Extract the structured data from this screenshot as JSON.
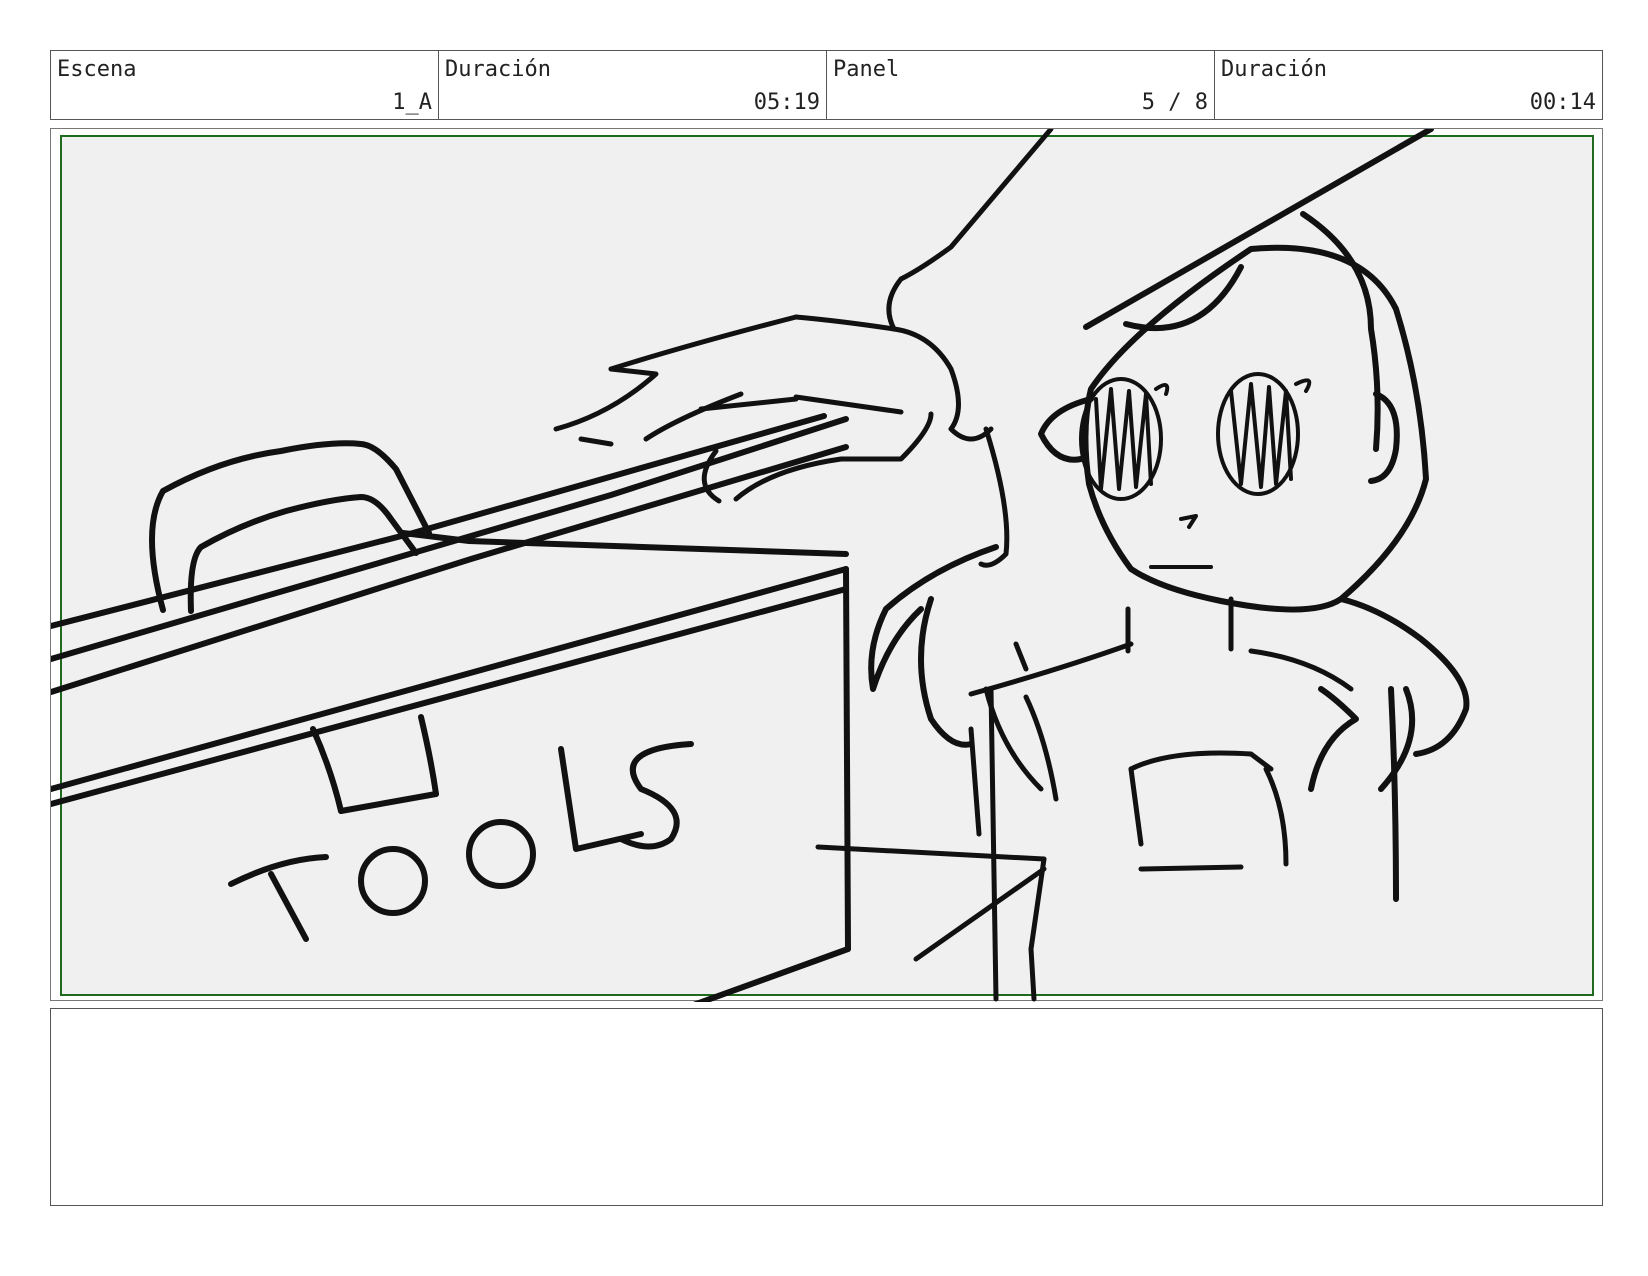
{
  "header": {
    "scene_label": "Escena",
    "scene_value": "1_A",
    "scene_duration_label": "Duración",
    "scene_duration_value": "05:19",
    "panel_label": "Panel",
    "panel_value": "5 / 8",
    "panel_duration_label": "Duración",
    "panel_duration_value": "00:14"
  },
  "drawing": {
    "box_text": "TOOLS",
    "safe_area_color": "#1e6b1e",
    "background_color": "#f0f0f0"
  },
  "notes": {
    "text": ""
  }
}
